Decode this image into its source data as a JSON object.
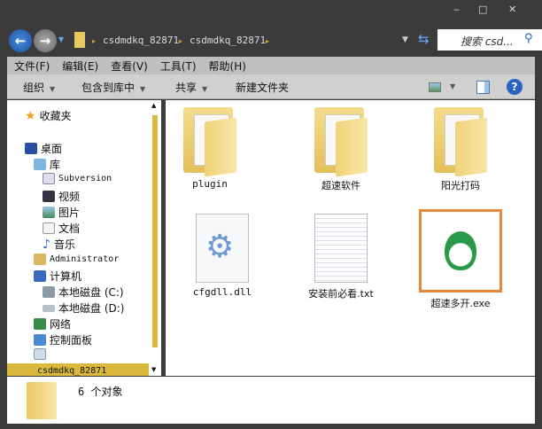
{
  "window": {
    "minimize": "‒",
    "maximize": "□",
    "close": "✕"
  },
  "address": {
    "crumbs": [
      "csdmdkq_82871",
      "csdmdkq_82871"
    ],
    "search_placeholder": "搜索 csd..."
  },
  "menu": [
    "文件(F)",
    "编辑(E)",
    "查看(V)",
    "工具(T)",
    "帮助(H)"
  ],
  "toolbar": {
    "organize": "组织",
    "include": "包含到库中",
    "share": "共享",
    "new_folder": "新建文件夹"
  },
  "nav": {
    "favorites": "收藏夹",
    "desktop": "桌面",
    "library": "库",
    "subversion": "Subversion",
    "video": "视频",
    "pictures": "图片",
    "documents": "文档",
    "music": "音乐",
    "admin": "Administrator",
    "computer": "计算机",
    "disk_c": "本地磁盘 (C:)",
    "disk_d": "本地磁盘 (D:)",
    "network": "网络",
    "control_panel": "控制面板",
    "selected": "csdmdkq_82871"
  },
  "files": [
    "plugin",
    "超速软件",
    "阳光打码",
    "cfgdll.dll",
    "安装前必看.txt",
    "超速多开.exe"
  ],
  "status": {
    "count": "6 个对象"
  },
  "colors": {
    "highlight": "#e8873a",
    "scroll": "#d9b83c"
  }
}
